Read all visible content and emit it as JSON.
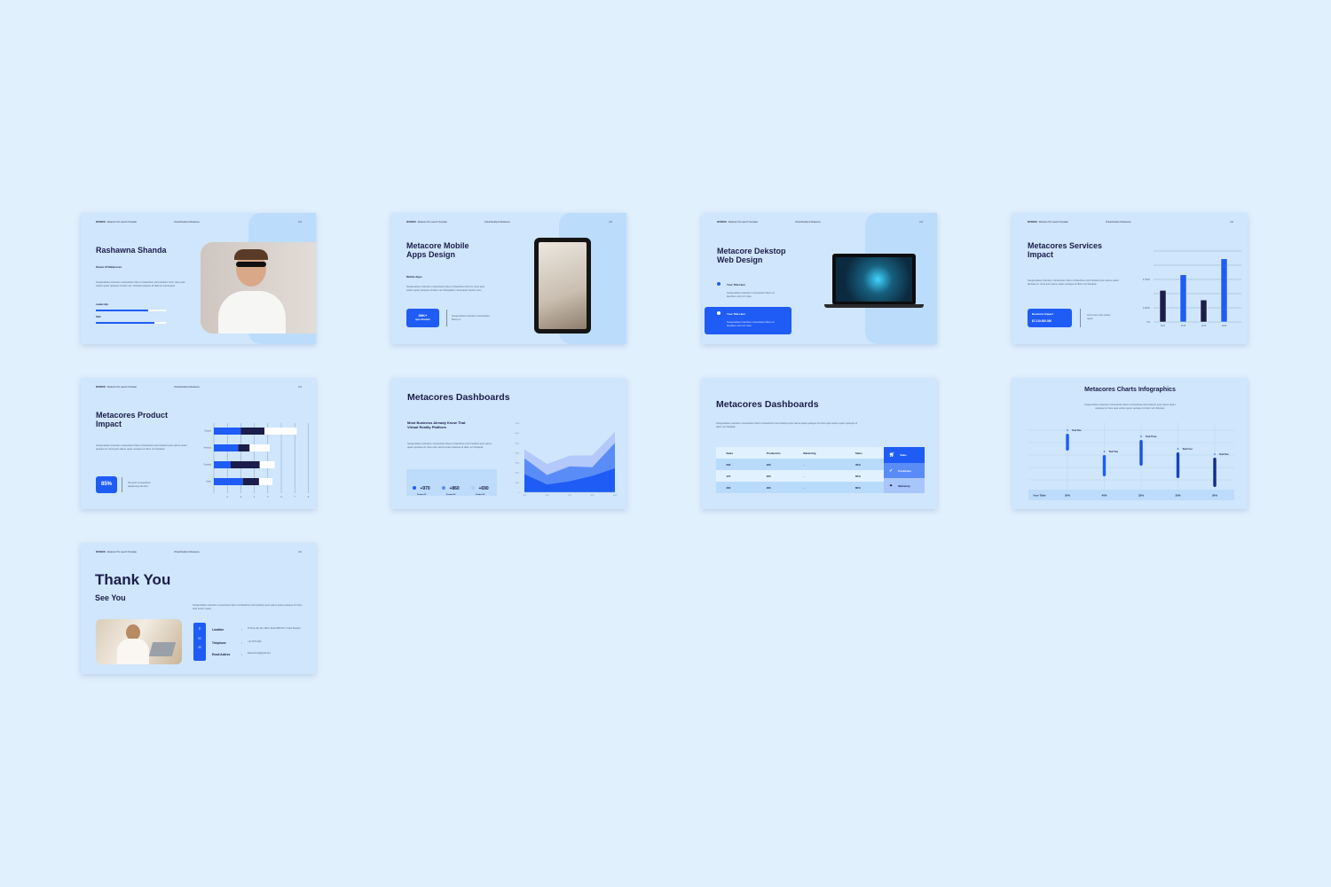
{
  "header": {
    "brand": "MODERN",
    "template": "Metacore Pro Launch Template",
    "topic": "Virtual Reality & Metaverse",
    "page": "| 01"
  },
  "colors": {
    "background": "#e1f0fd",
    "slide": "#cfe6fc",
    "accent": "#1f5cf5",
    "navy": "#1b1d4a",
    "light": "#a9c6fb"
  },
  "body_text": "Suspendisse interdum consectetur libero id faucibus nisl tincidunt. Arcu risus quis varius quam quisque id diam vel. Volutpat quisque id diamus consequat.",
  "slides": {
    "profile": {
      "name": "Rashawna Shanda",
      "role": "Owner Of  Metacores",
      "skills": [
        {
          "label": "Leadership",
          "level": 75
        },
        {
          "label": "Skill",
          "level": 84
        }
      ]
    },
    "mobile": {
      "title1": "Metacore Mobile",
      "title2": "Apps Design",
      "subtitle": "Mobile Apps",
      "text": "Suspendisse interdum consectetur libero id faucibus nisl ti Ar risus quis varius quam quisque id diam vel Volutpatfpo consequat mauris nunc.",
      "stat_value": "80K+",
      "stat_label": "Apps Simulator",
      "note": "Suspendisse interdum consectetur libero id."
    },
    "desktop": {
      "title1": "Metacore Dekstop",
      "title2": "Web Design",
      "items": [
        {
          "title": "Your Title Here",
          "text": "Suspendisse interdum consectetur libero id faucibus nisl ti Ar risus."
        },
        {
          "title": "Your Title Here",
          "text": "Suspendisse interdum consectetur libero id faucibus nisl ti Ar risus."
        }
      ]
    },
    "services": {
      "title1": "Metacores Services",
      "title2": "Impact",
      "text": "Suspendisse interdum consectetur libero id faucibus nisl tincidunt quis varius quam quisque Ar risus quis varius quam quisque id diam vel Volutpat.",
      "box_label": "Business Impact",
      "box_value": "$7.210.000.000",
      "note": "Arcu risus quis varius quam"
    },
    "product": {
      "title1": "Metacores Product",
      "title2": "Impact",
      "text": "Suspendisse interdum consectetur libero id faucibus nisl tincidunt quis varius quam quisque Ar risus quis varius quam quisque id diam vel Volutpat.",
      "percent": "85%",
      "note": "Sit amet consectetur adipiscing elit duis."
    },
    "dash1": {
      "title": "Metacores Dashboards",
      "subtitle1": "Most Business Already Know That",
      "subtitle2": "Virtual  Reality Platform",
      "text": "Suspendisse interdum consectetur libero id faucibus nisl tincidunt quis varius quam quisque Ar risus quis varius quam quisque id diam vel Volutpat.",
      "stats": [
        {
          "value": "+970",
          "label": "Product 01",
          "color": "#1f5cf5"
        },
        {
          "value": "+860",
          "label": "Product 02",
          "color": "#5a8cf7"
        },
        {
          "value": "+690",
          "label": "Product 03",
          "color": "#b3c8fb"
        }
      ]
    },
    "dash2": {
      "title": "Metacores Dashboards",
      "text": "Suspendisse interdum consectetur libero id faucibus nisl tincidunt quis varius quam quisque Ar risus quis varius quam quisque id diam vel Volutpat.",
      "columns": [
        "Sales",
        "Production",
        "Marketing",
        "Sales"
      ],
      "rows": [
        [
          "200",
          "220",
          "-",
          "40%"
        ],
        [
          "170",
          "250",
          "-",
          "65%"
        ],
        [
          "300",
          "290",
          "-",
          "80%"
        ]
      ],
      "side": [
        {
          "label": "Sales",
          "icon": "cart-icon"
        },
        {
          "label": "Production",
          "icon": "check-circle-icon"
        },
        {
          "label": "Marketing",
          "icon": "handshake-icon"
        }
      ]
    },
    "infographic": {
      "title": "Metacores Charts Infographics",
      "text1": "Suspendisse interdum consectetur libero id faucibus nisl tincidunt quis varius quam",
      "text2": "quisque Ar risus quis varius quam quisque id diam vel Volutpat.",
      "row_label": "Your Tittle"
    },
    "thanks": {
      "title": "Thank You",
      "subtitle": "See You",
      "text": "Suspendisse interdum consectetur libero id faucibus nisl tincidunt quis varius quam quisque Ar risus quis varius quam.",
      "contacts": [
        {
          "label": "Location",
          "value": "25 Alma Vale Rd, Clifton, Bristol BS8 2HY, United Kingdom",
          "icon": "location-icon"
        },
        {
          "label": "Telephone",
          "value": "+44 7975 4200",
          "icon": "phone-icon"
        },
        {
          "label": "Email Addres",
          "value": "Metacoreinfo@gmail.com",
          "icon": "mail-icon"
        }
      ]
    }
  },
  "chart_data": [
    {
      "type": "bar",
      "categories": [
        "2017",
        "2018",
        "2019",
        "2020"
      ],
      "values": [
        4450,
        6650,
        3100,
        8900
      ],
      "ytick_labels": [
        "0%",
        "3,250%",
        "6,750%"
      ],
      "colors": [
        "#1b1d4a",
        "#1f5cf5",
        "#1b1d4a",
        "#1f5cf5"
      ]
    },
    {
      "type": "bar",
      "orientation": "horizontal",
      "stacked": true,
      "categories": [
        "Europe",
        "America",
        "Oceania",
        "Asian"
      ],
      "series": [
        {
          "values": [
            2.0,
            1.8,
            1.25,
            2.15
          ],
          "color": "#1f5cf5"
        },
        {
          "values": [
            1.75,
            0.85,
            2.15,
            1.2
          ],
          "color": "#1b1d4a"
        },
        {
          "values": [
            2.4,
            1.5,
            1.1,
            1.0
          ],
          "color": "#ffffff"
        }
      ],
      "xticks": [
        "2",
        "3",
        "4",
        "5",
        "6",
        "7",
        "8"
      ],
      "xlim": [
        1,
        8
      ]
    },
    {
      "type": "area",
      "stacked": true,
      "x": [
        "1/02",
        "4/02",
        "7/02",
        "8/02",
        "9/02"
      ],
      "series": [
        {
          "values": [
            1840,
            790,
            1110,
            1660,
            2420
          ],
          "color": "#1f5cf5"
        },
        {
          "values": [
            1600,
            960,
            1510,
            880,
            2570
          ],
          "color": "#5a8cf7"
        },
        {
          "values": [
            900,
            1110,
            1080,
            1190,
            1130
          ],
          "color": "#b3c8fb"
        }
      ],
      "yticks": [
        "0",
        "1000",
        "2000",
        "3000",
        "4000",
        "5000",
        "6000",
        "7000"
      ],
      "ylim": [
        0,
        7000
      ]
    },
    {
      "type": "bar",
      "categories": [
        "Task One",
        "Task Two",
        "Task Three",
        "Task Four",
        "Task Five"
      ],
      "values": [
        20,
        40,
        35,
        30,
        50
      ],
      "value_labels": [
        "20%",
        "40%",
        "35%",
        "30%",
        "50%"
      ]
    }
  ]
}
